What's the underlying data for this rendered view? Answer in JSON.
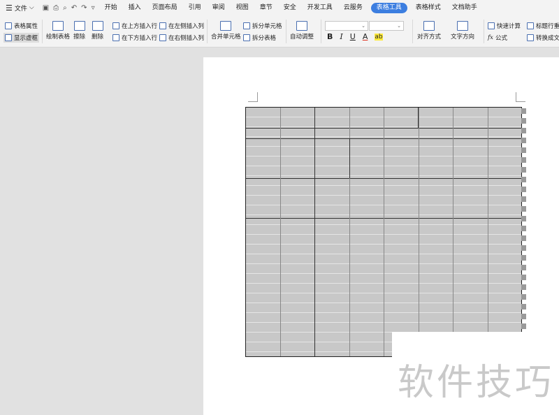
{
  "menubar": {
    "file_label": "文件",
    "tabs": [
      "开始",
      "插入",
      "页面布局",
      "引用",
      "审阅",
      "视图",
      "章节",
      "安全",
      "开发工具",
      "云服务",
      "表格工具",
      "表格样式",
      "文档助手"
    ],
    "active_tab": "表格工具"
  },
  "ribbon": {
    "table_props": "表格属性",
    "show_grid": "显示虚框",
    "draw_table": "绘制表格",
    "erase": "擦除",
    "delete": "删除",
    "insert_above": "在上方插入行",
    "insert_below": "在下方插入行",
    "insert_left": "在左侧插入列",
    "insert_right": "在右侧插入列",
    "merge_cells": "合并单元格",
    "split_cells": "拆分单元格",
    "split_table": "拆分表格",
    "auto_adjust": "自动调整",
    "align": "对齐方式",
    "text_direction": "文字方向",
    "quick_calc": "快速计算",
    "formula": "公式",
    "header_repeat": "标题行重",
    "convert_text": "转换成文"
  },
  "format": {
    "bold": "B",
    "italic": "I",
    "underline": "U",
    "font_color": "A",
    "highlight": "ab"
  },
  "watermark": "软件技巧",
  "colors": {
    "accent": "#3c7ee0",
    "table_fill": "#c8c8c8"
  }
}
